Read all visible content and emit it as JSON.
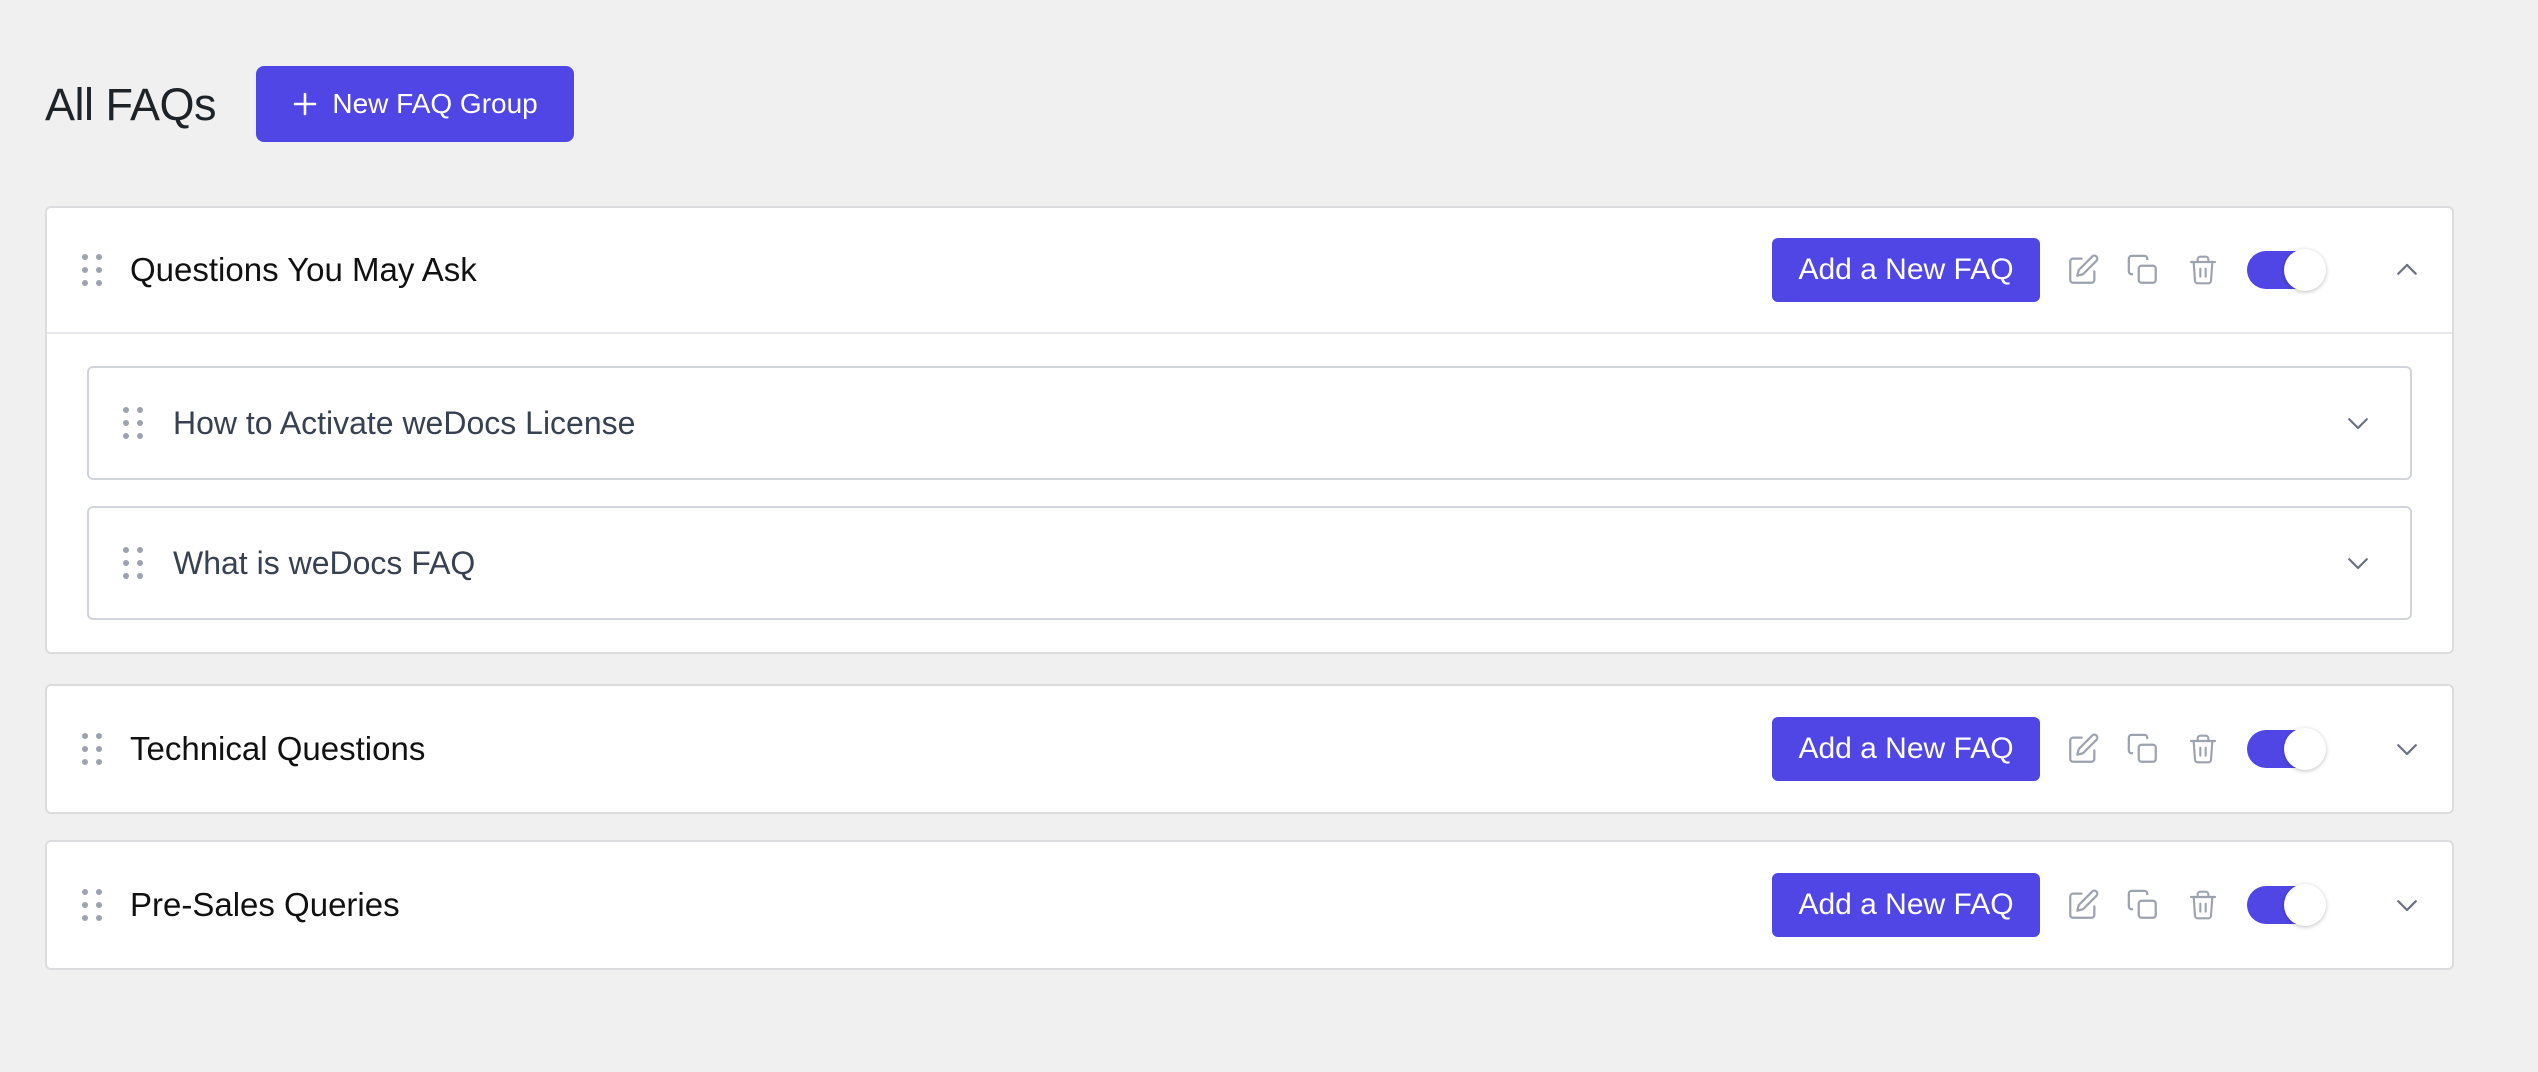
{
  "header": {
    "title": "All FAQs",
    "new_group_label": "New FAQ Group"
  },
  "colors": {
    "accent": "#4f46e5",
    "background": "#f0f0f1",
    "icon_gray": "#9ca3af"
  },
  "groups": [
    {
      "title": "Questions You May Ask",
      "add_label": "Add a New FAQ",
      "enabled": true,
      "expanded": true,
      "faqs": [
        {
          "title": "How to Activate weDocs License"
        },
        {
          "title": "What is weDocs FAQ"
        }
      ]
    },
    {
      "title": "Technical Questions",
      "add_label": "Add a New FAQ",
      "enabled": true,
      "expanded": false,
      "faqs": []
    },
    {
      "title": "Pre-Sales Queries",
      "add_label": "Add a New FAQ",
      "enabled": true,
      "expanded": false,
      "faqs": []
    }
  ],
  "icons": {
    "plus": "plus-icon",
    "drag": "drag-handle-icon",
    "edit": "pencil-edit-icon",
    "copy": "copy-icon",
    "trash": "trash-icon",
    "chevron_up": "chevron-up-icon",
    "chevron_down": "chevron-down-icon"
  }
}
